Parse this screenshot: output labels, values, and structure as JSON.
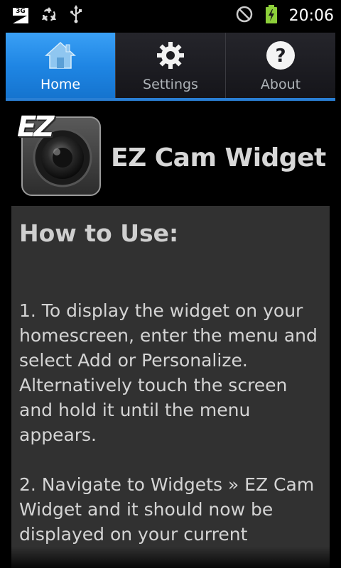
{
  "statusbar": {
    "network_label": "3G",
    "time": "20:06",
    "icons": [
      "3g-data-icon",
      "recycle-icon",
      "usb-icon",
      "no-sim-icon",
      "battery-charging-icon"
    ]
  },
  "tabs": [
    {
      "label": "Home",
      "icon": "home-icon",
      "active": true
    },
    {
      "label": "Settings",
      "icon": "gear-icon",
      "active": false
    },
    {
      "label": "About",
      "icon": "help-icon",
      "active": false
    }
  ],
  "header": {
    "logo_text": "EZ",
    "title": "EZ Cam Widget"
  },
  "content": {
    "heading": "How to Use:",
    "step1": "1. To display the widget on your homescreen, enter the menu and select Add or Personalize. Alternatively touch the screen and hold it until the menu appears.",
    "step2": "2. Navigate to Widgets » EZ Cam Widget and it should now be displayed on your current"
  },
  "colors": {
    "accent": "#1f86e4",
    "content_bg": "#313131"
  }
}
